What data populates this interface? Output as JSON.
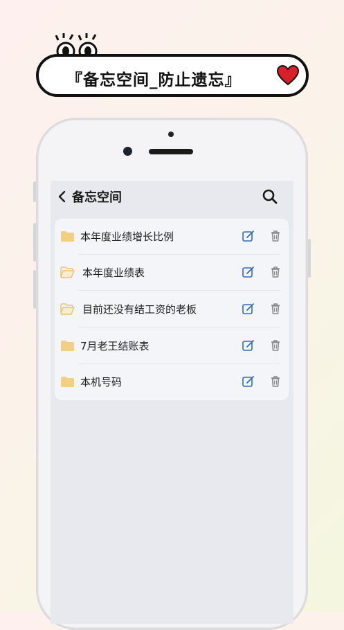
{
  "banner": {
    "title": "『备忘空间_防止遗忘』"
  },
  "screen": {
    "title": "备忘空间",
    "back_icon": "chevron-left-icon",
    "search_icon": "search-icon"
  },
  "folders": [
    {
      "name": "本年度业绩增长比例",
      "icon": "folder-filled-icon"
    },
    {
      "name": "本年度业绩表",
      "icon": "folder-open-icon"
    },
    {
      "name": "目前还没有结工资的老板",
      "icon": "folder-open-icon"
    },
    {
      "name": "7月老王结账表",
      "icon": "folder-filled-icon"
    },
    {
      "name": "本机号码",
      "icon": "folder-filled-icon"
    }
  ],
  "colors": {
    "folder": "#f2cf83",
    "edit": "#2d6db2",
    "delete": "#8a8a8a",
    "heart": "#d81f2a"
  }
}
